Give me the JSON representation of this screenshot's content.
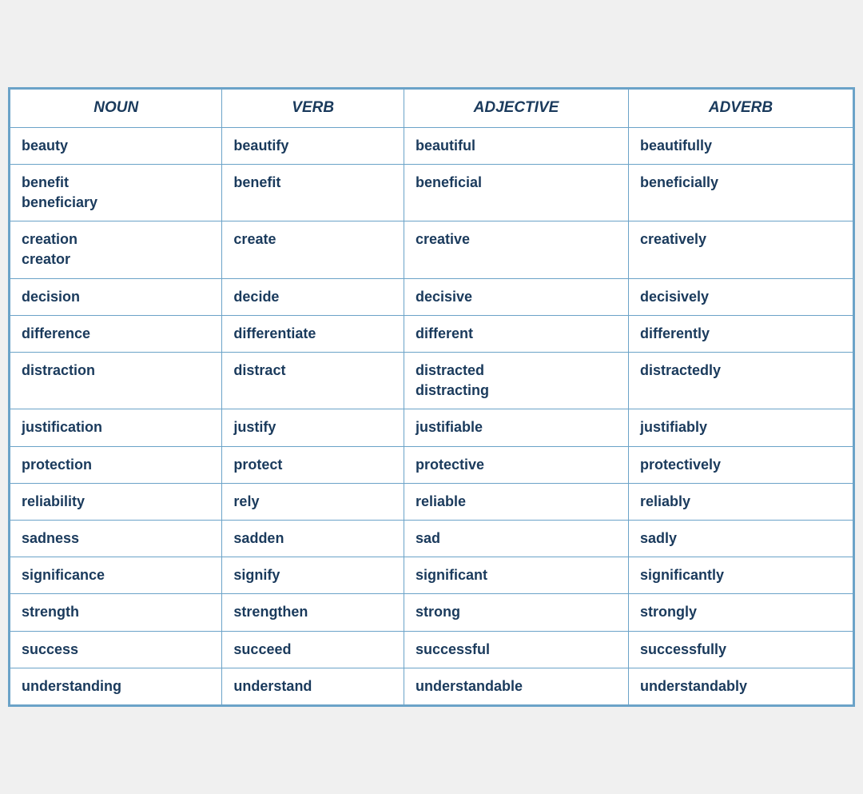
{
  "headers": {
    "col1": "NOUN",
    "col2": "VERB",
    "col3": "ADJECTIVE",
    "col4": "ADVERB"
  },
  "rows": [
    {
      "noun": "beauty",
      "verb": "beautify",
      "adjective": "beautiful",
      "adverb": "beautifully"
    },
    {
      "noun": "benefit\nbeneficiary",
      "verb": "benefit",
      "adjective": "beneficial",
      "adverb": "beneficially"
    },
    {
      "noun": "creation\ncreator",
      "verb": "create",
      "adjective": "creative",
      "adverb": "creatively"
    },
    {
      "noun": "decision",
      "verb": "decide",
      "adjective": "decisive",
      "adverb": "decisively"
    },
    {
      "noun": "difference",
      "verb": "differentiate",
      "adjective": "different",
      "adverb": "differently"
    },
    {
      "noun": "distraction",
      "verb": "distract",
      "adjective": "distracted\ndistracting",
      "adverb": "distractedly"
    },
    {
      "noun": "justification",
      "verb": "justify",
      "adjective": "justifiable",
      "adverb": "justifiably"
    },
    {
      "noun": "protection",
      "verb": "protect",
      "adjective": "protective",
      "adverb": "protectively"
    },
    {
      "noun": "reliability",
      "verb": "rely",
      "adjective": "reliable",
      "adverb": "reliably"
    },
    {
      "noun": "sadness",
      "verb": "sadden",
      "adjective": "sad",
      "adverb": "sadly"
    },
    {
      "noun": "significance",
      "verb": "signify",
      "adjective": "significant",
      "adverb": "significantly"
    },
    {
      "noun": "strength",
      "verb": "strengthen",
      "adjective": "strong",
      "adverb": "strongly"
    },
    {
      "noun": "success",
      "verb": "succeed",
      "adjective": "successful",
      "adverb": "successfully"
    },
    {
      "noun": "understanding",
      "verb": "understand",
      "adjective": "understandable",
      "adverb": "understandably"
    }
  ]
}
